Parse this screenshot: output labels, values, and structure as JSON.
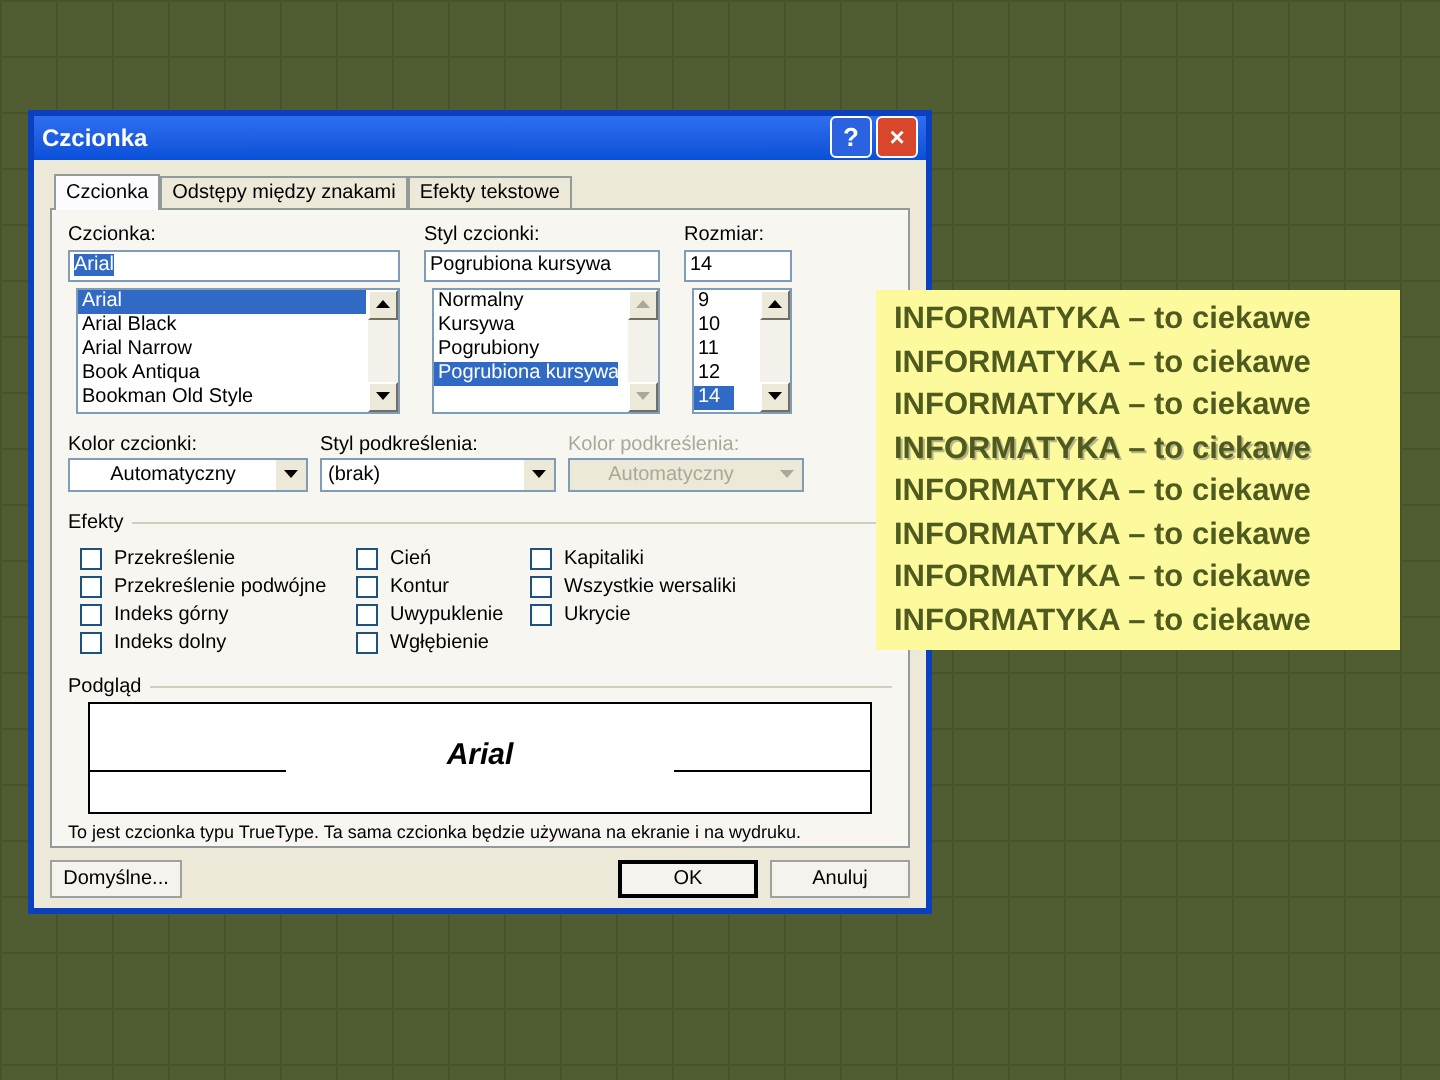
{
  "window": {
    "title": "Czcionka",
    "buttons": [
      "?",
      "×"
    ]
  },
  "tabs": [
    {
      "label": "Czcionka",
      "selected": true
    },
    {
      "label": "Odstępy między znakami",
      "selected": false
    },
    {
      "label": "Efekty tekstowe",
      "selected": false
    }
  ],
  "font": {
    "label": "Czcionka:",
    "value": "Arial",
    "items": [
      {
        "label": "Arial",
        "selected": true
      },
      {
        "label": "Arial Black",
        "selected": false
      },
      {
        "label": "Arial Narrow",
        "selected": false
      },
      {
        "label": "Book Antiqua",
        "selected": false
      },
      {
        "label": "Bookman Old Style",
        "selected": false
      }
    ]
  },
  "style": {
    "label": "Styl czcionki:",
    "value": "Pogrubiona kursywa",
    "items": [
      {
        "label": "Normalny",
        "selected": false
      },
      {
        "label": "Kursywa",
        "selected": false
      },
      {
        "label": "Pogrubiony",
        "selected": false
      },
      {
        "label": "Pogrubiona kursywa",
        "selected": true
      }
    ]
  },
  "size": {
    "label": "Rozmiar:",
    "value": "14",
    "items": [
      {
        "label": "9",
        "selected": false
      },
      {
        "label": "10",
        "selected": false
      },
      {
        "label": "11",
        "selected": false
      },
      {
        "label": "12",
        "selected": false
      },
      {
        "label": "14",
        "selected": true
      }
    ]
  },
  "dropdowns": [
    {
      "label": "Kolor czcionki:",
      "value": "Automatyczny",
      "disabled": false,
      "centered": true
    },
    {
      "label": "Styl podkreślenia:",
      "value": "(brak)",
      "disabled": false,
      "centered": false
    },
    {
      "label": "Kolor podkreślenia:",
      "value": "Automatyczny",
      "disabled": true,
      "centered": true
    }
  ],
  "effects": {
    "title": "Efekty",
    "columns": [
      [
        {
          "label": "Przekreślenie",
          "checked": false
        },
        {
          "label": "Przekreślenie podwójne",
          "checked": false
        },
        {
          "label": "Indeks górny",
          "checked": false
        },
        {
          "label": "Indeks dolny",
          "checked": false
        }
      ],
      [
        {
          "label": "Cień",
          "checked": false
        },
        {
          "label": "Kontur",
          "checked": false
        },
        {
          "label": "Uwypuklenie",
          "checked": false
        },
        {
          "label": "Wgłębienie",
          "checked": false
        }
      ],
      [
        {
          "label": "Kapitaliki",
          "checked": false
        },
        {
          "label": "Wszystkie wersaliki",
          "checked": false
        },
        {
          "label": "Ukrycie",
          "checked": false
        }
      ]
    ]
  },
  "preview": {
    "title": "Podgląd",
    "sample": "Arial",
    "note": "To jest czcionka typu TrueType. Ta sama czcionka będzie używana na ekranie i na wydruku."
  },
  "footer_buttons": [
    {
      "label": "Domyślne...",
      "default": false
    },
    {
      "label": "OK",
      "default": true
    },
    {
      "label": "Anuluj",
      "default": false
    }
  ],
  "note_box": {
    "lines": [
      {
        "text": "INFORMATYKA – to ciekawe",
        "shadow": false
      },
      {
        "text": "INFORMATYKA – to ciekawe",
        "shadow": false
      },
      {
        "text": "INFORMATYKA – to ciekawe",
        "shadow": false
      },
      {
        "text": "INFORMATYKA – to ciekawe",
        "shadow": true
      },
      {
        "text": "INFORMATYKA – to ciekawe",
        "shadow": false
      },
      {
        "text": "INFORMATYKA – to ciekawe",
        "shadow": false
      },
      {
        "text": "INFORMATYKA – to ciekawe",
        "shadow": false
      },
      {
        "text": "INFORMATYKA – to ciekawe",
        "shadow": false
      }
    ]
  }
}
